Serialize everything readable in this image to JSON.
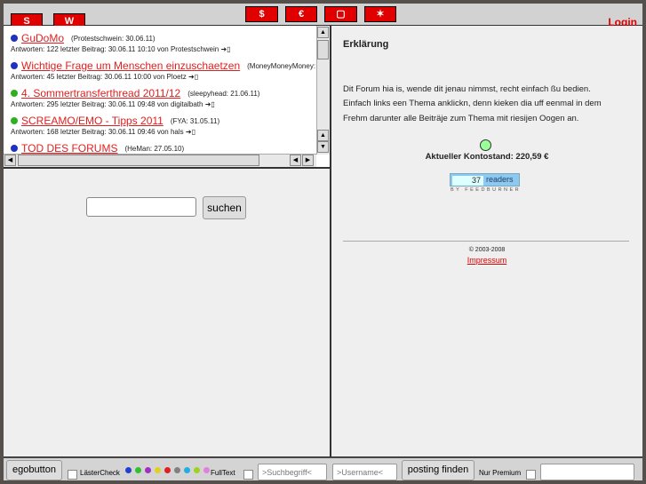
{
  "top": {
    "login": "Login",
    "icons": [
      "logo-icon-1",
      "logo-icon-2",
      "money-icon",
      "shop-icon",
      "book-icon",
      "bird-icon"
    ]
  },
  "topics": [
    {
      "title": "GuDoMo",
      "by": "(Protestschwein: 30.06.11)",
      "meta": "Antworten: 122  letzter Beitrag: 30.06.11 10:10 von Protestschwein",
      "dot": "#2030c0"
    },
    {
      "title": "Wichtige Frage um Menschen einzuschaetzen",
      "by": "(MoneyMoneyMoney:",
      "meta": "Antworten: 45  letzter Beitrag: 30.06.11 10:00 von Ploetz",
      "dot": "#2030c0"
    },
    {
      "title": "4. Sommertransferthread 2011/12",
      "by": "(sleepyhead: 21.06.11)",
      "meta": "Antworten: 295  letzter Beitrag: 30.06.11 09:48 von digitalbath",
      "dot": "#30b020"
    },
    {
      "title": "SCREAMO/EMO - Tipps 2011",
      "by": "(FYA: 31.05.11)",
      "meta": "Antworten: 168  letzter Beitrag: 30.06.11 09:46 von hals",
      "dot": "#30b020"
    },
    {
      "title": "TOD DES FORUMS",
      "by": "(HeMan: 27.05.10)",
      "meta": "",
      "dot": "#2030c0"
    }
  ],
  "search": {
    "button": "suchen",
    "value": ""
  },
  "right": {
    "heading": "Erklärung",
    "lines": [
      "Dit Forum hia is, wende dit jenau nimmst, recht einfach ßu bedien.",
      "Einfach links een Thema anklickn, denn kieken dia uff eenmal in dem",
      "Frehm darunter alle Beiträje zum Thema mit riesijen Oogen an."
    ],
    "konto": "Aktueller Kontostand: 220,59 €",
    "feed_count": "37",
    "feed_label": "readers",
    "feed_by": "BY FEEDBURNER",
    "copyright": "© 2003-2008",
    "impressum": "Impressum"
  },
  "bottom": {
    "egobutton": "egobutton",
    "laestercheck": "LästerCheck",
    "fulltext": "FullText",
    "search_placeholder": ">Suchbegriff<",
    "user_placeholder": ">Username<",
    "find": "posting finden",
    "premium": "Nur Premium",
    "dots": [
      "#2040d0",
      "#30c030",
      "#a030c0",
      "#e0d020",
      "#e02020",
      "#808080",
      "#20b0e0",
      "#a0d020",
      "#e080e0"
    ]
  }
}
